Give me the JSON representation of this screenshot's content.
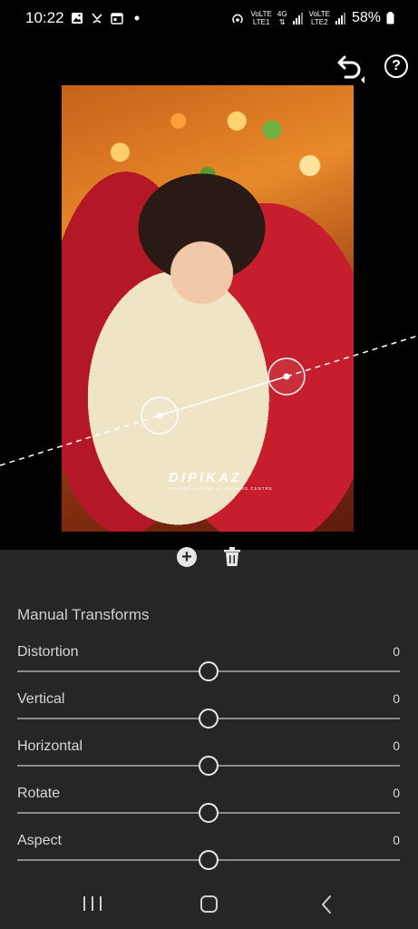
{
  "status_bar": {
    "time": "10:22",
    "left_icons": [
      "gallery-icon",
      "missed-call-icon",
      "calendar-icon",
      "dot-icon"
    ],
    "right_icons": [
      "hotspot-icon",
      "signal-icon",
      "wifi-icon",
      "battery-icon"
    ],
    "net1_top": "VoLTE",
    "net1_bottom": "LTE1",
    "net_type": "4G",
    "net2_top": "VoLTE",
    "net2_bottom": "LTE2",
    "battery": "58%"
  },
  "toolbar": {
    "undo_icon": "undo-icon",
    "help_label": "?"
  },
  "photo": {
    "watermark": "DIPIKAZ",
    "watermark_sub": "MAKEUP STUDIO & TRAINING CENTRE"
  },
  "guide_actions": {
    "add_label": "+",
    "delete_icon": "trash-icon"
  },
  "panel": {
    "title": "Manual Transforms",
    "sliders": [
      {
        "label": "Distortion",
        "value": "0",
        "position": 0.5
      },
      {
        "label": "Vertical",
        "value": "0",
        "position": 0.5
      },
      {
        "label": "Horizontal",
        "value": "0",
        "position": 0.5
      },
      {
        "label": "Rotate",
        "value": "0",
        "position": 0.5
      },
      {
        "label": "Aspect",
        "value": "0",
        "position": 0.5
      }
    ]
  },
  "nav": {
    "icons": [
      "recents-icon",
      "home-icon",
      "back-icon"
    ]
  },
  "colors": {
    "background": "#000000",
    "panel": "#262626",
    "text": "#d6d6d6",
    "track": "#8a8a8a"
  }
}
